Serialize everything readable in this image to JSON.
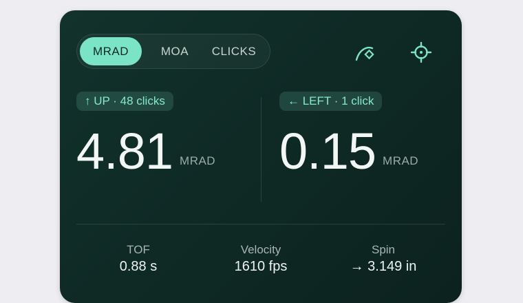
{
  "units": {
    "tabs": [
      {
        "label": "MRAD",
        "active": true
      },
      {
        "label": "MOA",
        "active": false
      },
      {
        "label": "CLICKS",
        "active": false
      }
    ]
  },
  "toolbar": {
    "icons": [
      "trajectory-icon",
      "crosshair-icon"
    ],
    "accent": "#7be3c6"
  },
  "elevation": {
    "badge": "↑ UP · 48 clicks",
    "value": "4.81",
    "unit": "MRAD"
  },
  "windage": {
    "badge": "← LEFT · 1 click",
    "value": "0.15",
    "unit": "MRAD"
  },
  "stats": [
    {
      "label": "TOF",
      "value": "0.88 s"
    },
    {
      "label": "Velocity",
      "value": "1610 fps"
    },
    {
      "label": "Spin",
      "value": "→ 3.149 in"
    }
  ]
}
